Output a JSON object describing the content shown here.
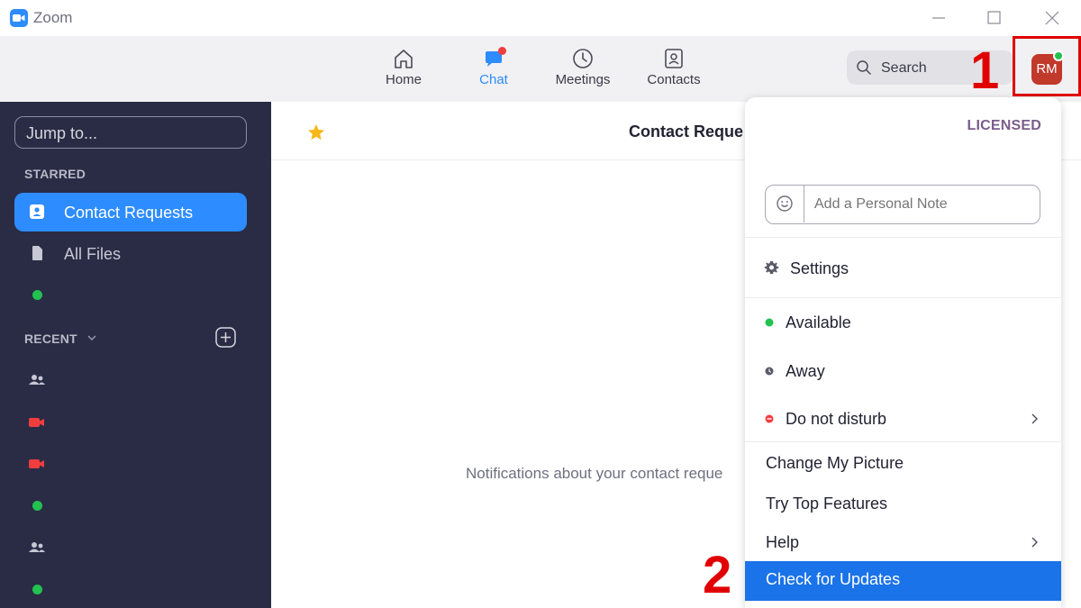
{
  "window": {
    "title": "Zoom"
  },
  "nav": {
    "tabs": [
      {
        "label": "Home",
        "icon": "home-icon"
      },
      {
        "label": "Chat",
        "icon": "chat-icon"
      },
      {
        "label": "Meetings",
        "icon": "clock-icon"
      },
      {
        "label": "Contacts",
        "icon": "contacts-icon"
      }
    ],
    "active_tab": "Chat",
    "search_label": "Search",
    "avatar_initials": "RM",
    "accent_color": "#2D8CFF"
  },
  "annotations": {
    "step1": "1",
    "step2": "2",
    "color": "#e10000"
  },
  "sidebar": {
    "jump_placeholder": "Jump to...",
    "starred_label": "STARRED",
    "recent_label": "RECENT",
    "starred_items": [
      {
        "label": "Contact Requests",
        "icon": "contact-card-icon",
        "active": true
      },
      {
        "label": "All Files",
        "icon": "file-icon",
        "active": false
      }
    ],
    "recent_icons": [
      "people-icon",
      "video-icon",
      "video-icon",
      "green-dot",
      "people-icon",
      "green-dot"
    ]
  },
  "main": {
    "title": "Contact Reque",
    "message": "Notifications about your contact reque"
  },
  "menu": {
    "licensed": "LICENSED",
    "note_placeholder": "Add a Personal Note",
    "items": {
      "settings": "Settings",
      "available": "Available",
      "away": "Away",
      "dnd": "Do not disturb",
      "change_picture": "Change My Picture",
      "top_features": "Try Top Features",
      "help": "Help",
      "check_updates": "Check for Updates"
    }
  }
}
